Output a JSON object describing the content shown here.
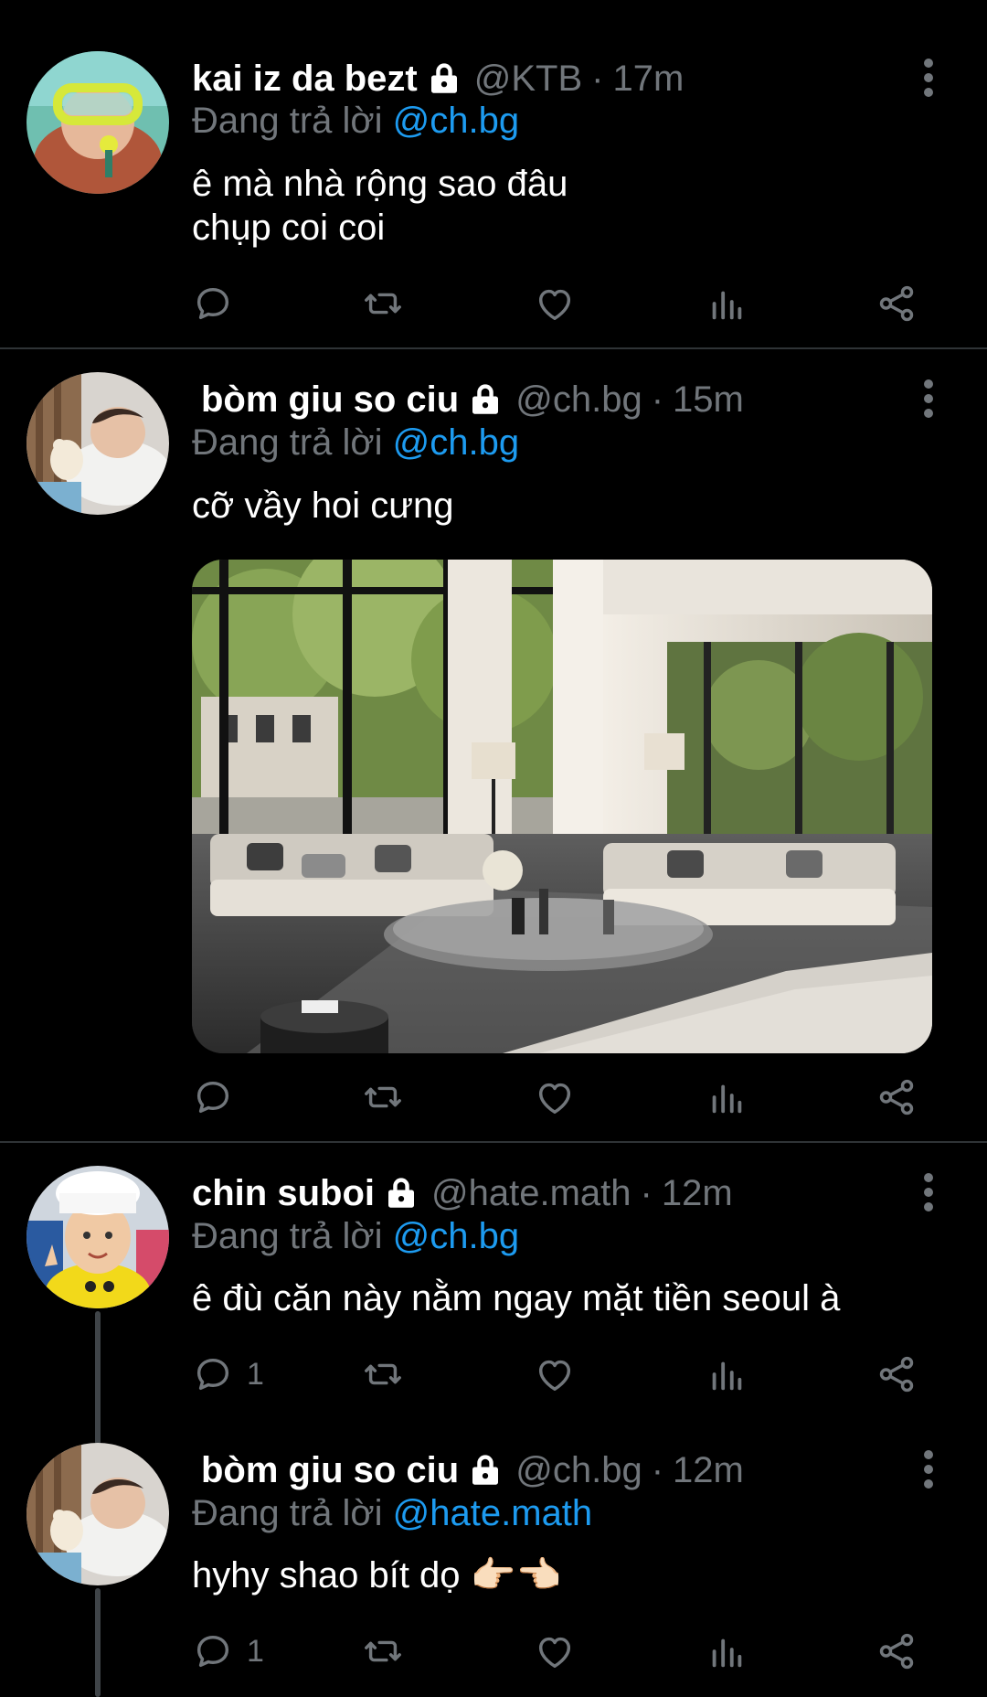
{
  "posts": [
    {
      "name": "kai iz da bezt",
      "handle": "@KTB",
      "separator": "·",
      "time": "17m",
      "reply_prefix": "Đang trả lời",
      "reply_to": "@ch.bg",
      "text": "ê mà nhà rộng sao đâu\nchụp coi coi",
      "reply_count": ""
    },
    {
      "name": "bòm giu so ciu",
      "handle": "@ch.bg",
      "separator": "·",
      "time": "15m",
      "reply_prefix": "Đang trả lời",
      "reply_to": "@ch.bg",
      "text": "cỡ vầy hoi cưng",
      "reply_count": ""
    },
    {
      "name": "chin suboi",
      "handle": "@hate.math",
      "separator": "·",
      "time": "12m",
      "reply_prefix": "Đang trả lời",
      "reply_to": "@ch.bg",
      "text": "ê đù căn này nằm ngay mặt tiền seoul à",
      "reply_count": "1"
    },
    {
      "name": "bòm giu so ciu",
      "handle": "@ch.bg",
      "separator": "·",
      "time": "12m",
      "reply_prefix": "Đang trả lời",
      "reply_to": "@hate.math",
      "text": "hyhy shao bít dọ 👉🏻👈🏻",
      "reply_count": "1"
    }
  ],
  "icons": {
    "lock": "lock-icon",
    "more": "more-vertical-icon",
    "reply": "reply-icon",
    "repost": "repost-icon",
    "like": "heart-icon",
    "views": "views-icon",
    "share": "share-icon"
  },
  "colors": {
    "background": "#000000",
    "name": "#ffffff",
    "secondary": "#71767b",
    "mention": "#1d9bf0",
    "divider": "#2f3336"
  }
}
